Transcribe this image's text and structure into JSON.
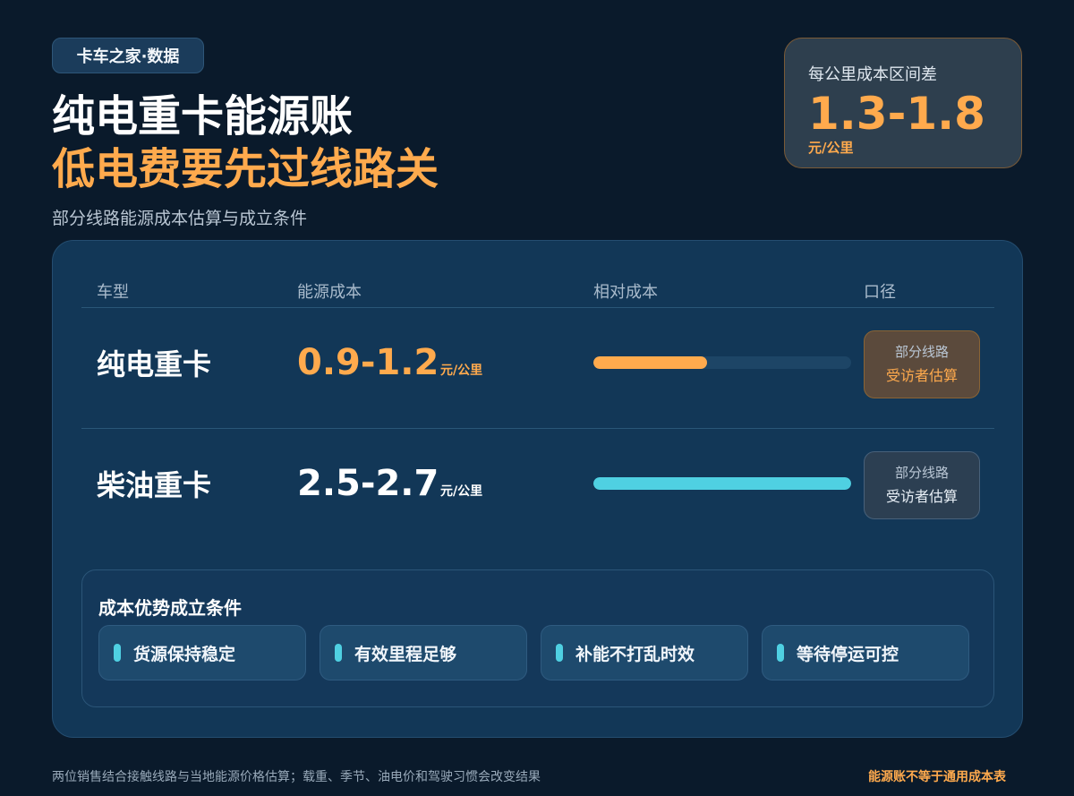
{
  "brand_badge": "卡车之家·数据",
  "title_line1": "纯电重卡能源账",
  "title_line2": "低电费要先过线路关",
  "subtitle": "部分线路能源成本估算与成立条件",
  "range_card": {
    "label": "每公里成本区间差",
    "value": "1.3-1.8",
    "unit": "元/公里"
  },
  "table": {
    "headers": [
      "车型",
      "能源成本",
      "相对成本",
      "口径"
    ],
    "rows": [
      {
        "type": "纯电重卡",
        "value": "0.9-1.2",
        "unit": "元/公里",
        "relative_cost_fraction": 0.44,
        "bar_color": "#ffaa4d",
        "scope_line1": "部分线路",
        "scope_line2": "受访者估算"
      },
      {
        "type": "柴油重卡",
        "value": "2.5-2.7",
        "unit": "元/公里",
        "relative_cost_fraction": 1.0,
        "bar_color": "#4fd0e2",
        "scope_line1": "部分线路",
        "scope_line2": "受访者估算"
      }
    ]
  },
  "conditions": {
    "title": "成本优势成立条件",
    "items": [
      "货源保持稳定",
      "有效里程足够",
      "补能不打乱时效",
      "等待停运可控"
    ]
  },
  "footer": {
    "note": "两位销售结合接触线路与当地能源价格估算；载重、季节、油电价和驾驶习惯会改变结果",
    "tag": "能源账不等于通用成本表"
  },
  "colors": {
    "accent": "#ffaa4d",
    "accent_cyan": "#4fd0e2",
    "background": "#0a1a2b"
  }
}
